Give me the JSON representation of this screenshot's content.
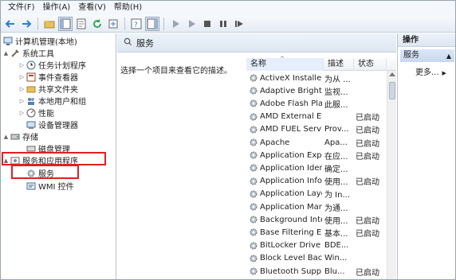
{
  "menu": [
    "文件(F)",
    "操作(A)",
    "查看(V)",
    "帮助(H)"
  ],
  "tree": [
    {
      "label": "计算机管理(本地)",
      "indent": 0,
      "arrow": "",
      "icon": "computer-icon"
    },
    {
      "label": "系统工具",
      "indent": 1,
      "arrow": "▲",
      "icon": "tools-icon"
    },
    {
      "label": "任务计划程序",
      "indent": 2,
      "arrow": "▷",
      "icon": "clock-icon"
    },
    {
      "label": "事件查看器",
      "indent": 2,
      "arrow": "▷",
      "icon": "event-viewer-icon"
    },
    {
      "label": "共享文件夹",
      "indent": 2,
      "arrow": "▷",
      "icon": "shared-folder-icon"
    },
    {
      "label": "本地用户和组",
      "indent": 2,
      "arrow": "▷",
      "icon": "users-icon"
    },
    {
      "label": "性能",
      "indent": 2,
      "arrow": "▷",
      "icon": "performance-icon"
    },
    {
      "label": "设备管理器",
      "indent": 2,
      "arrow": "",
      "icon": "device-manager-icon"
    },
    {
      "label": "存储",
      "indent": 1,
      "arrow": "▲",
      "icon": "storage-icon"
    },
    {
      "label": "磁盘管理",
      "indent": 2,
      "arrow": "",
      "icon": "disk-icon"
    },
    {
      "label": "服务和应用程序",
      "indent": 1,
      "arrow": "▲",
      "icon": "services-apps-icon"
    },
    {
      "label": "服务",
      "indent": 2,
      "arrow": "",
      "icon": "gear-icon"
    },
    {
      "label": "WMI 控件",
      "indent": 2,
      "arrow": "",
      "icon": "wmi-icon"
    }
  ],
  "center": {
    "title": "服务",
    "description": "选择一个项目来查看它的描述。",
    "columns": {
      "name": "名称",
      "desc": "描述",
      "status": "状态"
    }
  },
  "services": [
    {
      "name": "ActiveX Installer ...",
      "desc": "为从 ...",
      "status": ""
    },
    {
      "name": "Adaptive Brightn...",
      "desc": "监视...",
      "status": ""
    },
    {
      "name": "Adobe Flash Pla...",
      "desc": "此服...",
      "status": ""
    },
    {
      "name": "AMD External Ev...",
      "desc": "",
      "status": "已启动"
    },
    {
      "name": "AMD FUEL Service",
      "desc": "Prov...",
      "status": "已启动"
    },
    {
      "name": "Apache",
      "desc": "Apa...",
      "status": "已启动"
    },
    {
      "name": "Application Expe...",
      "desc": "在应...",
      "status": "已启动"
    },
    {
      "name": "Application Iden...",
      "desc": "确定...",
      "status": ""
    },
    {
      "name": "Application Infor...",
      "desc": "使用...",
      "status": "已启动"
    },
    {
      "name": "Application Laye...",
      "desc": "为 In...",
      "status": ""
    },
    {
      "name": "Application Man...",
      "desc": "为通...",
      "status": ""
    },
    {
      "name": "Background Inte...",
      "desc": "使用...",
      "status": "已启动"
    },
    {
      "name": "Base Filtering En...",
      "desc": "基本...",
      "status": "已启动"
    },
    {
      "name": "BitLocker Drive ...",
      "desc": "BDE...",
      "status": ""
    },
    {
      "name": "Block Level Back...",
      "desc": "Win...",
      "status": ""
    },
    {
      "name": "Bluetooth Supp...",
      "desc": "Blu...",
      "status": "已启动"
    }
  ],
  "actions": {
    "header": "操作",
    "section": "服务",
    "more": "更多..."
  },
  "colors": {
    "highlight_box": "#e02020",
    "pane_header": "#dde6f2",
    "accent_blue": "#2f6fc3"
  }
}
